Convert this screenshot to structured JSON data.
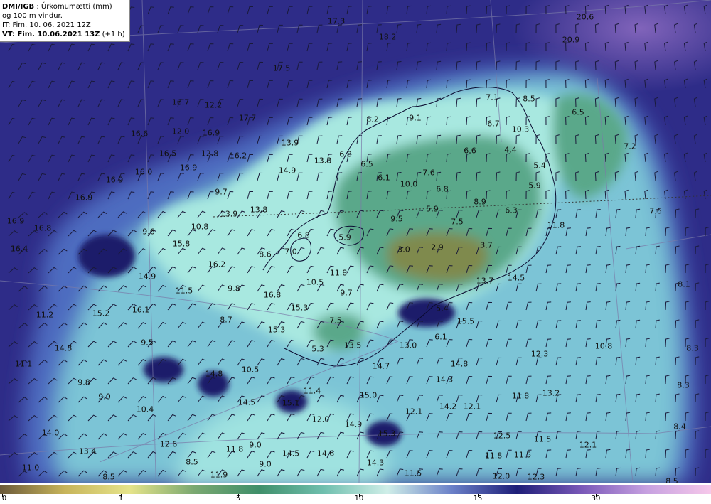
{
  "header": {
    "source": "DMI/IGB",
    "title": "Úrkomumætti (mm)",
    "subtitle": "og 100 m vindur.",
    "it": "IT: Fim. 10. 06. 2021 12Z",
    "vt": "VT: Fim. 10.06.2021 13Z",
    "vt_offset": "(+1 h)"
  },
  "colors": {
    "ocean_deep": "#2c2a86",
    "ocean_mid": "#3a48a8",
    "moist": "#8fd6cf",
    "land_green": "#4f9b7a",
    "land_dry": "#8a8a4a",
    "high_purple": "#8a6ac0"
  },
  "legend": {
    "ticks": [
      {
        "label": "0",
        "value": 0
      },
      {
        "label": "1",
        "value": 1
      },
      {
        "label": "5",
        "value": 5
      },
      {
        "label": "10",
        "value": 10
      },
      {
        "label": "15",
        "value": 15
      },
      {
        "label": "30",
        "value": 30
      }
    ],
    "colors": [
      "#6b5a3a",
      "#c7b45a",
      "#e6e48a",
      "#7aa870",
      "#3f8f6a",
      "#6fbfae",
      "#cfeee8",
      "#6a80c8",
      "#1e1e78",
      "#7a58b8",
      "#c6a0e0",
      "#f6c8ea"
    ]
  },
  "map_values": [
    {
      "t": "17.3",
      "v": 17.3
    },
    {
      "t": "18.2",
      "v": 18.2
    },
    {
      "t": "20.6",
      "v": 20.6
    },
    {
      "t": "20.9",
      "v": 20.9
    },
    {
      "t": "17.5",
      "v": 17.5
    },
    {
      "t": "16.7",
      "v": 16.7
    },
    {
      "t": "12.2",
      "v": 12.2
    },
    {
      "t": "17.7",
      "v": 17.7
    },
    {
      "t": "8.2",
      "v": 8.2
    },
    {
      "t": "9.1",
      "v": 9.1
    },
    {
      "t": "7.1",
      "v": 7.1
    },
    {
      "t": "8.5",
      "v": 8.5
    },
    {
      "t": "6.5",
      "v": 6.5
    },
    {
      "t": "16.6",
      "v": 16.6
    },
    {
      "t": "12.0",
      "v": 12.0
    },
    {
      "t": "16.9",
      "v": 16.9
    },
    {
      "t": "6.7",
      "v": 6.7
    },
    {
      "t": "10.3",
      "v": 10.3
    },
    {
      "t": "13.9",
      "v": 13.9
    },
    {
      "t": "16.5",
      "v": 16.5
    },
    {
      "t": "12.8",
      "v": 12.8
    },
    {
      "t": "16.2",
      "v": 16.2
    },
    {
      "t": "13.8",
      "v": 13.8
    },
    {
      "t": "6.8",
      "v": 6.8
    },
    {
      "t": "6.6",
      "v": 6.6
    },
    {
      "t": "4.4",
      "v": 4.4
    },
    {
      "t": "7.2",
      "v": 7.2
    },
    {
      "t": "16.0",
      "v": 16.0
    },
    {
      "t": "16.9",
      "v": 16.9
    },
    {
      "t": "14.9",
      "v": 14.9
    },
    {
      "t": "6.5",
      "v": 6.5
    },
    {
      "t": "5.4",
      "v": 5.4
    },
    {
      "t": "16.9",
      "v": 16.9
    },
    {
      "t": "6.1",
      "v": 6.1
    },
    {
      "t": "7.6",
      "v": 7.6
    },
    {
      "t": "10.0",
      "v": 10.0
    },
    {
      "t": "6.8",
      "v": 6.8
    },
    {
      "t": "5.9",
      "v": 5.9
    },
    {
      "t": "9.7",
      "v": 9.7
    },
    {
      "t": "16.9",
      "v": 16.9
    },
    {
      "t": "8.9",
      "v": 8.9
    },
    {
      "t": "13.9",
      "v": 13.9
    },
    {
      "t": "13.8",
      "v": 13.8
    },
    {
      "t": "5.9",
      "v": 5.9
    },
    {
      "t": "6.3",
      "v": 6.3
    },
    {
      "t": "7.6",
      "v": 7.6
    },
    {
      "t": "16.9",
      "v": 16.9
    },
    {
      "t": "9.5",
      "v": 9.5
    },
    {
      "t": "16.8",
      "v": 16.8
    },
    {
      "t": "10.8",
      "v": 10.8
    },
    {
      "t": "7.5",
      "v": 7.5
    },
    {
      "t": "11.8",
      "v": 11.8
    },
    {
      "t": "9.6",
      "v": 9.6
    },
    {
      "t": "6.8",
      "v": 6.8
    },
    {
      "t": "5.9",
      "v": 5.9
    },
    {
      "t": "15.8",
      "v": 15.8
    },
    {
      "t": "16.4",
      "v": 16.4
    },
    {
      "t": "7.0",
      "v": 7.0
    },
    {
      "t": "3.0",
      "v": 3.0
    },
    {
      "t": "2.9",
      "v": 2.9
    },
    {
      "t": "3.7",
      "v": 3.7
    },
    {
      "t": "8.6",
      "v": 8.6
    },
    {
      "t": "16.2",
      "v": 16.2
    },
    {
      "t": "11.8",
      "v": 11.8
    },
    {
      "t": "14.9",
      "v": 14.9
    },
    {
      "t": "13.7",
      "v": 13.7
    },
    {
      "t": "14.5",
      "v": 14.5
    },
    {
      "t": "10.5",
      "v": 10.5
    },
    {
      "t": "11.5",
      "v": 11.5
    },
    {
      "t": "9.8",
      "v": 9.8
    },
    {
      "t": "16.8",
      "v": 16.8
    },
    {
      "t": "9.7",
      "v": 9.7
    },
    {
      "t": "8.1",
      "v": 8.1
    },
    {
      "t": "16.1",
      "v": 16.1
    },
    {
      "t": "15.3",
      "v": 15.3
    },
    {
      "t": "5.4",
      "v": 5.4
    },
    {
      "t": "11.2",
      "v": 11.2
    },
    {
      "t": "15.2",
      "v": 15.2
    },
    {
      "t": "15.5",
      "v": 15.5
    },
    {
      "t": "8.7",
      "v": 8.7
    },
    {
      "t": "7.5",
      "v": 7.5
    },
    {
      "t": "15.3",
      "v": 15.3
    },
    {
      "t": "6.1",
      "v": 6.1
    },
    {
      "t": "9.5",
      "v": 9.5
    },
    {
      "t": "13.5",
      "v": 13.5
    },
    {
      "t": "13.0",
      "v": 13.0
    },
    {
      "t": "10.8",
      "v": 10.8
    },
    {
      "t": "14.8",
      "v": 14.8
    },
    {
      "t": "5.3",
      "v": 5.3
    },
    {
      "t": "8.3",
      "v": 8.3
    },
    {
      "t": "12.3",
      "v": 12.3
    },
    {
      "t": "11.1",
      "v": 11.1
    },
    {
      "t": "14.8",
      "v": 14.8
    },
    {
      "t": "10.5",
      "v": 10.5
    },
    {
      "t": "14.7",
      "v": 14.7
    },
    {
      "t": "14.8",
      "v": 14.8
    },
    {
      "t": "14.3",
      "v": 14.3
    },
    {
      "t": "9.8",
      "v": 9.8
    },
    {
      "t": "11.4",
      "v": 11.4
    },
    {
      "t": "9.0",
      "v": 9.0
    },
    {
      "t": "15.0",
      "v": 15.0
    },
    {
      "t": "11.8",
      "v": 11.8
    },
    {
      "t": "13.2",
      "v": 13.2
    },
    {
      "t": "8.3",
      "v": 8.3
    },
    {
      "t": "14.5",
      "v": 14.5
    },
    {
      "t": "15.1",
      "v": 15.1
    },
    {
      "t": "10.4",
      "v": 10.4
    },
    {
      "t": "12.1",
      "v": 12.1
    },
    {
      "t": "14.2",
      "v": 14.2
    },
    {
      "t": "12.1",
      "v": 12.1
    },
    {
      "t": "12.0",
      "v": 12.0
    },
    {
      "t": "14.0",
      "v": 14.0
    },
    {
      "t": "14.9",
      "v": 14.9
    },
    {
      "t": "8.4",
      "v": 8.4
    },
    {
      "t": "12.6",
      "v": 12.6
    },
    {
      "t": "9.0",
      "v": 9.0
    },
    {
      "t": "15.3",
      "v": 15.3
    },
    {
      "t": "12.5",
      "v": 12.5
    },
    {
      "t": "11.5",
      "v": 11.5
    },
    {
      "t": "13.4",
      "v": 13.4
    },
    {
      "t": "11.8",
      "v": 11.8
    },
    {
      "t": "12.1",
      "v": 12.1
    },
    {
      "t": "14.5",
      "v": 14.5
    },
    {
      "t": "14.6",
      "v": 14.6
    },
    {
      "t": "11.8",
      "v": 11.8
    },
    {
      "t": "11.5",
      "v": 11.5
    },
    {
      "t": "8.5",
      "v": 8.5
    },
    {
      "t": "9.0",
      "v": 9.0
    },
    {
      "t": "14.3",
      "v": 14.3
    },
    {
      "t": "11.0",
      "v": 11.0
    },
    {
      "t": "11.5",
      "v": 11.5
    },
    {
      "t": "8.5",
      "v": 8.5
    },
    {
      "t": "11.9",
      "v": 11.9
    },
    {
      "t": "12.0",
      "v": 12.0
    },
    {
      "t": "12.3",
      "v": 12.3
    },
    {
      "t": "8.5",
      "v": 8.5
    }
  ]
}
